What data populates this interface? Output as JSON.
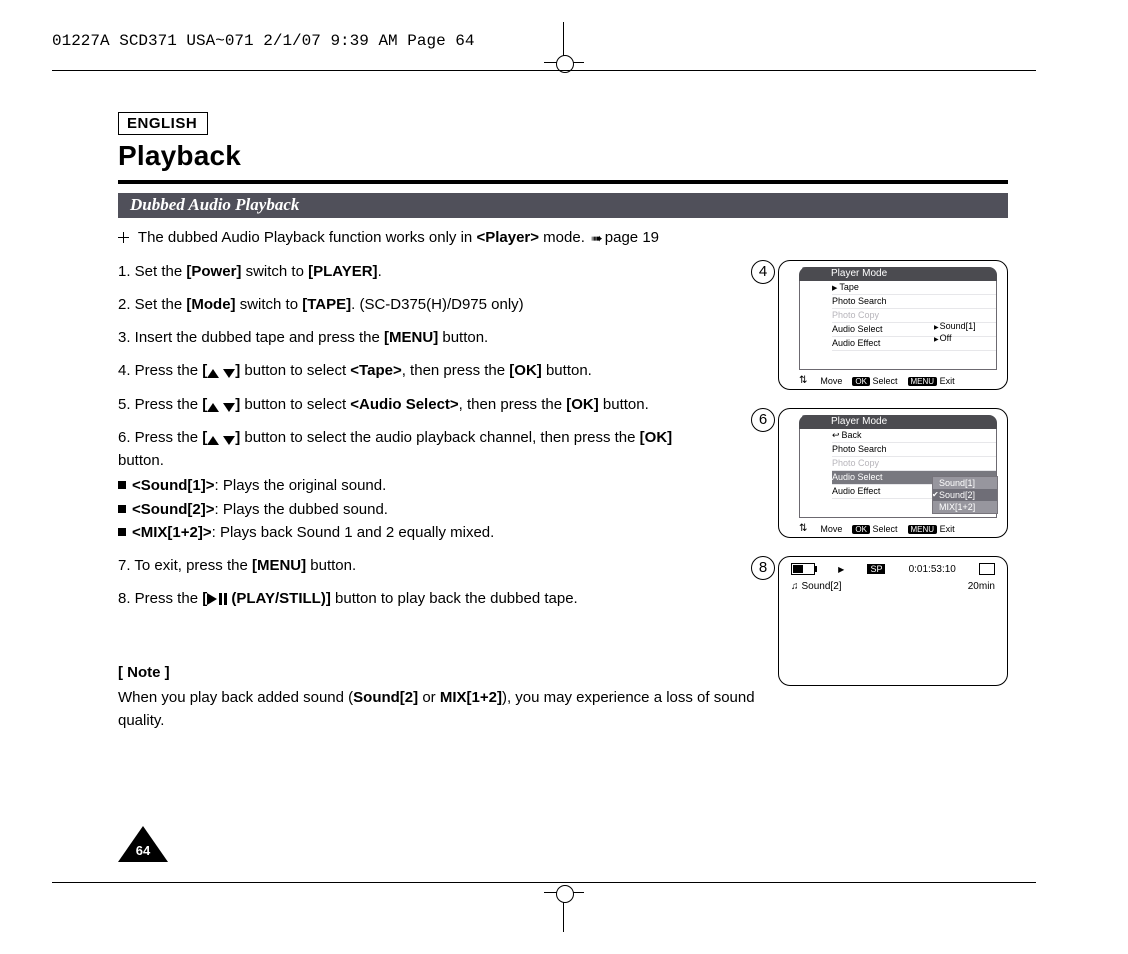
{
  "header": "01227A SCD371 USA~071  2/1/07 9:39 AM  Page 64",
  "language_label": "ENGLISH",
  "title": "Playback",
  "section_heading": "Dubbed Audio Playback",
  "intro_banner": {
    "pre": "The dubbed Audio Playback function works only in ",
    "bold": "<Player>",
    "post": " mode. ",
    "link": "page 19"
  },
  "steps": {
    "s1": {
      "pre": "1. Set the ",
      "b1": "[Power]",
      "mid": " switch to ",
      "b2": "[PLAYER]",
      "post": "."
    },
    "s2": {
      "pre": "2. Set the ",
      "b1": "[Mode]",
      "mid": " switch to ",
      "b2": "[TAPE]",
      "post": ". (SC-D375(H)/D975 only)"
    },
    "s3": {
      "pre": "3. Insert the dubbed tape and press the ",
      "b1": "[MENU]",
      "post": " button."
    },
    "s4": {
      "pre": "4. Press the ",
      "b1_left": "[",
      "b1_right": "]",
      "mid": " button to select ",
      "b2": "<Tape>",
      "mid2": ", then press the ",
      "b3": "[OK]",
      "post": " button."
    },
    "s5": {
      "pre": "5. Press the ",
      "b1_left": "[",
      "b1_right": "]",
      "mid": " button to select ",
      "b2": "<Audio Select>",
      "mid2": ", then press the ",
      "b3": "[OK]",
      "post": " button."
    },
    "s6": {
      "pre": "6. Press the ",
      "b1_left": "[",
      "b1_right": "]",
      "mid": " button to select the audio playback channel, then press the ",
      "b2": "[OK]",
      "post": " button."
    },
    "s6a": {
      "b": "<Sound[1]>",
      "t": ": Plays the original sound."
    },
    "s6b": {
      "b": "<Sound[2]>",
      "t": ": Plays the dubbed sound."
    },
    "s6c": {
      "b": "<MIX[1+2]>",
      "t": ": Plays back Sound 1 and 2 equally mixed."
    },
    "s7": {
      "pre": "7. To exit, press the ",
      "b1": "[MENU]",
      "post": " button."
    },
    "s8": {
      "pre": "8. Press the ",
      "b1_left": "[",
      "b1_right": "(PLAY/STILL)]",
      "post": " button to play back the dubbed tape."
    }
  },
  "note": {
    "heading": "[ Note ]",
    "line_pre": "When you play back added sound (",
    "b1": "Sound[2]",
    "mid": " or ",
    "b2": "MIX[1+2]",
    "line_post": "), you may experience a loss of sound quality."
  },
  "page_number": "64",
  "fig4": {
    "step": "4",
    "title": "Player Mode",
    "items": [
      "Tape",
      "Photo Search",
      "Photo Copy",
      "Audio Select",
      "Audio Effect"
    ],
    "sub": [
      "Sound[1]",
      "Off"
    ],
    "foot": {
      "move": "Move",
      "ok": "OK",
      "select": "Select",
      "menu": "MENU",
      "exit": "Exit"
    }
  },
  "fig6": {
    "step": "6",
    "title": "Player Mode",
    "items": [
      "Back",
      "Photo Search",
      "Photo Copy",
      "Audio Select",
      "Audio Effect"
    ],
    "sub": [
      "Sound[1]",
      "Sound[2]",
      "MIX[1+2]"
    ],
    "foot": {
      "move": "Move",
      "ok": "OK",
      "select": "Select",
      "menu": "MENU",
      "exit": "Exit"
    }
  },
  "fig8": {
    "step": "8",
    "sp": "SP",
    "time": "0:01:53:10",
    "sound": "Sound[2]",
    "remain": "20min"
  }
}
